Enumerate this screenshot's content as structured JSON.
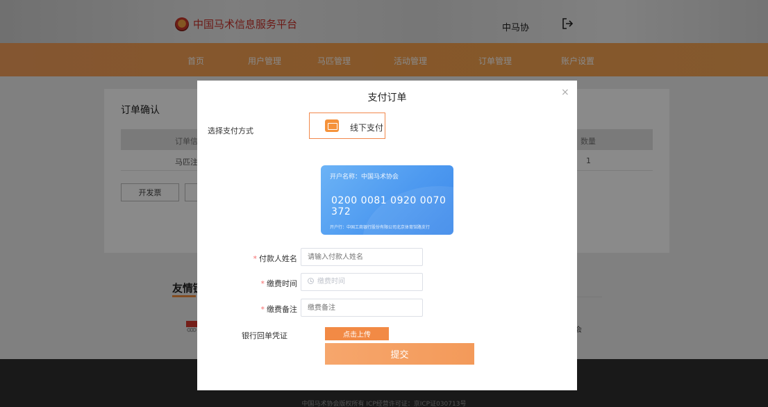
{
  "header": {
    "brand_title": "中国马术信息服务平台",
    "account_name": "中马协"
  },
  "nav": {
    "items": [
      {
        "label": "首页"
      },
      {
        "label": "用户管理"
      },
      {
        "label": "马匹管理"
      },
      {
        "label": "活动管理"
      },
      {
        "label": "订单管理"
      },
      {
        "label": "账户设置"
      }
    ]
  },
  "order_card": {
    "title": "订单确认",
    "col_left": "订单信息",
    "col_right": "数量",
    "row_left": "马匹注册",
    "row_right": "1",
    "invoice_button": "开发票"
  },
  "links": {
    "title": "友情链接"
  },
  "footer": {
    "text": "中国马术协会版权所有 ICP经营许可证：京ICP证030713号"
  },
  "modal": {
    "title": "支付订单",
    "close": "×",
    "pay_method_label": "选择支付方式",
    "pay_option": "线下支付",
    "bank_card": {
      "account_name": "开户名称：中国马术协会",
      "number": "0200 0081 0920 0070 372",
      "bank": "开户行：中国工商银行股份有限公司北京体育馆路支行"
    },
    "payer_name": {
      "label": "付款人姓名",
      "placeholder": "请输入付款人姓名"
    },
    "pay_time": {
      "label": "缴费时间",
      "placeholder": "缴费时间"
    },
    "pay_note": {
      "label": "缴费备注",
      "placeholder": "缴费备注"
    },
    "receipt_label": "银行回单凭证",
    "upload_button": "点击上传",
    "submit_button": "提交"
  },
  "colors": {
    "accent": "#f28a45",
    "nav": "#f7a24d",
    "card": "#4e9af0",
    "required": "#f56c6c"
  }
}
